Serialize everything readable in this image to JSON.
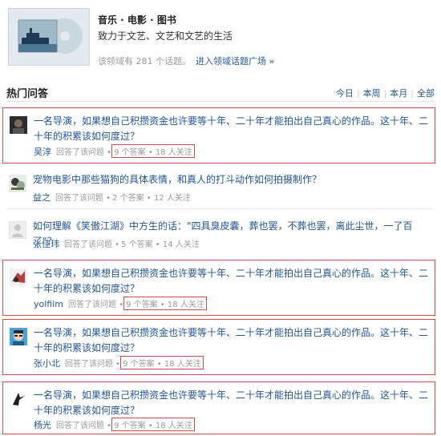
{
  "topic": {
    "title": "音乐 · 电影 · 图书",
    "desc": "致力于文艺、文艺和文艺的生活",
    "count_text": "该领域有 281 个话题。",
    "link": "进入领域话题广场 »"
  },
  "section": {
    "title": "热门问答",
    "filters": [
      "今日",
      "本周",
      "本月",
      "全部"
    ]
  },
  "questions": [
    {
      "question": "一名导演，如果想自己积攒资金也许要等十年、二十年才能拍出自己真心的作品。这十年、二十年的积累该如何度过？",
      "user": "吴淳",
      "action": "回答了该问题 •",
      "stats": "9 个答案 • 18 人关注",
      "highlighted": true
    },
    {
      "question": "宠物电影中那些猫狗的具体表情，和真人的打斗动作如何拍摄制作？",
      "user": "益之",
      "action": "回答了该问题 •",
      "stats": "2 个答案 • 12 人关注",
      "highlighted": false
    },
    {
      "question": "如何理解《笑傲江湖》中方生的话：\"四具臭皮囊，葬也罢，不葬也罢，离此尘世，一了百了\"？",
      "user": "张佳玮",
      "action": "回答了该问题 •",
      "stats": "5 个答案 • 14 人关注",
      "highlighted": false
    },
    {
      "question": "一名导演，如果想自己积攒资金也许要等十年、二十年才能拍出自己真心的作品。这十年、二十年的积累该如何度过？",
      "user": "yolfilm",
      "action": "回答了该问题 •",
      "stats": "9 个答案 • 18 人关注",
      "highlighted": true
    },
    {
      "question": "一名导演，如果想自己积攒资金也许要等十年、二十年才能拍出自己真心的作品。这十年、二十年的积累该如何度过？",
      "user": "张小北",
      "action": "回答了该问题 •",
      "stats": "9 个答案 • 18 人关注",
      "highlighted": true
    },
    {
      "question": "一名导演，如果想自己积攒资金也许要等十年、二十年才能拍出自己真心的作品。这十年、二十年的积累该如何度过？",
      "user": "杨光",
      "action": "回答了该问题 •",
      "stats": "9 个答案 • 18 人关注",
      "highlighted": true
    }
  ],
  "colors": {
    "link": "#225599",
    "highlight_border": "#d24a4a",
    "muted": "#999999"
  }
}
